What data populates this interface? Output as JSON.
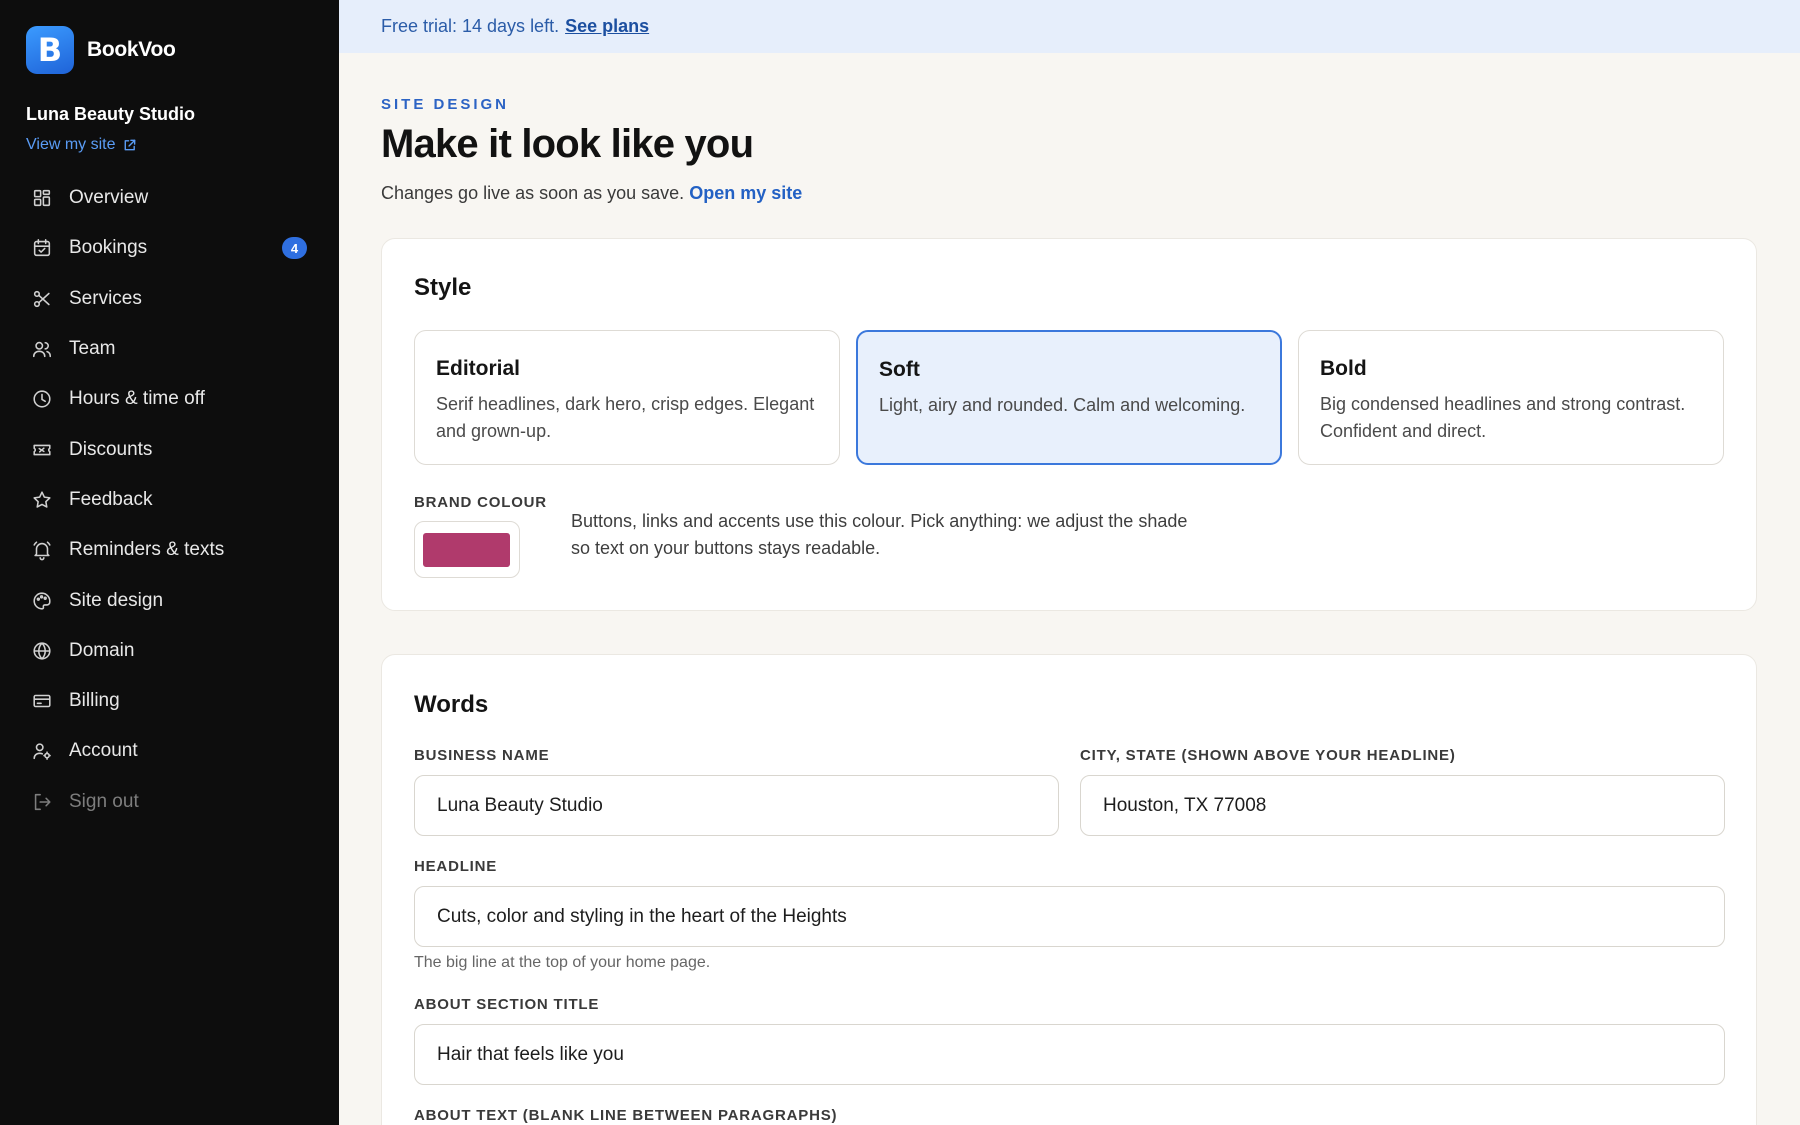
{
  "brand": {
    "logo_letter": "B",
    "name": "BookVoo"
  },
  "sidebar": {
    "studio_name": "Luna Beauty Studio",
    "view_site_label": "View my site",
    "items": [
      {
        "label": "Overview",
        "icon": "grid-icon"
      },
      {
        "label": "Bookings",
        "icon": "calendar-icon",
        "badge": "4"
      },
      {
        "label": "Services",
        "icon": "scissors-icon"
      },
      {
        "label": "Team",
        "icon": "users-icon"
      },
      {
        "label": "Hours & time off",
        "icon": "clock-icon"
      },
      {
        "label": "Discounts",
        "icon": "ticket-icon"
      },
      {
        "label": "Feedback",
        "icon": "star-icon"
      },
      {
        "label": "Reminders & texts",
        "icon": "bell-icon"
      },
      {
        "label": "Site design",
        "icon": "palette-icon"
      },
      {
        "label": "Domain",
        "icon": "globe-icon"
      },
      {
        "label": "Billing",
        "icon": "credit-card-icon"
      },
      {
        "label": "Account",
        "icon": "user-settings-icon"
      },
      {
        "label": "Sign out",
        "icon": "sign-out-icon"
      }
    ]
  },
  "trial": {
    "text": "Free trial: 14 days left.",
    "link": "See plans"
  },
  "header": {
    "eyebrow": "SITE DESIGN",
    "title": "Make it look like you",
    "subtitle": "Changes go live as soon as you save.",
    "subtitle_link": "Open my site"
  },
  "style_section": {
    "title": "Style",
    "options": [
      {
        "name": "Editorial",
        "description": "Serif headlines, dark hero, crisp edges. Elegant and grown-up.",
        "selected": false
      },
      {
        "name": "Soft",
        "description": "Light, airy and rounded. Calm and welcoming.",
        "selected": true
      },
      {
        "name": "Bold",
        "description": "Big condensed headlines and strong contrast. Confident and direct.",
        "selected": false
      }
    ],
    "brand_colour_label": "BRAND COLOUR",
    "brand_colour_value": "#b03a6c",
    "brand_colour_help": "Buttons, links and accents use this colour. Pick anything: we adjust the shade so text on your buttons stays readable."
  },
  "words_section": {
    "title": "Words",
    "business_name_label": "BUSINESS NAME",
    "business_name_value": "Luna Beauty Studio",
    "city_label": "CITY, STATE (SHOWN ABOVE YOUR HEADLINE)",
    "city_value": "Houston, TX 77008",
    "headline_label": "HEADLINE",
    "headline_value": "Cuts, color and styling in the heart of the Heights",
    "headline_hint": "The big line at the top of your home page.",
    "about_title_label": "ABOUT SECTION TITLE",
    "about_title_value": "Hair that feels like you",
    "about_text_label": "ABOUT TEXT (BLANK LINE BETWEEN PARAGRAPHS)"
  }
}
